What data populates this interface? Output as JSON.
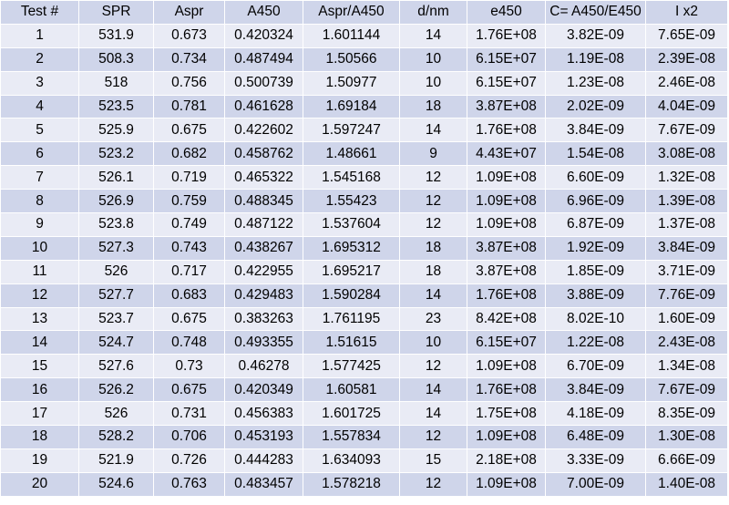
{
  "table": {
    "headers": [
      "Test #",
      "SPR",
      "Aspr",
      "A450",
      "Aspr/A450",
      "d/nm",
      "e450",
      "C= A450/E450",
      "I x2"
    ],
    "rows": [
      [
        "1",
        "531.9",
        "0.673",
        "0.420324",
        "1.601144",
        "14",
        "1.76E+08",
        "3.82E-09",
        "7.65E-09"
      ],
      [
        "2",
        "508.3",
        "0.734",
        "0.487494",
        "1.50566",
        "10",
        "6.15E+07",
        "1.19E-08",
        "2.39E-08"
      ],
      [
        "3",
        "518",
        "0.756",
        "0.500739",
        "1.50977",
        "10",
        "6.15E+07",
        "1.23E-08",
        "2.46E-08"
      ],
      [
        "4",
        "523.5",
        "0.781",
        "0.461628",
        "1.69184",
        "18",
        "3.87E+08",
        "2.02E-09",
        "4.04E-09"
      ],
      [
        "5",
        "525.9",
        "0.675",
        "0.422602",
        "1.597247",
        "14",
        "1.76E+08",
        "3.84E-09",
        "7.67E-09"
      ],
      [
        "6",
        "523.2",
        "0.682",
        "0.458762",
        "1.48661",
        "9",
        "4.43E+07",
        "1.54E-08",
        "3.08E-08"
      ],
      [
        "7",
        "526.1",
        "0.719",
        "0.465322",
        "1.545168",
        "12",
        "1.09E+08",
        "6.60E-09",
        "1.32E-08"
      ],
      [
        "8",
        "526.9",
        "0.759",
        "0.488345",
        "1.55423",
        "12",
        "1.09E+08",
        "6.96E-09",
        "1.39E-08"
      ],
      [
        "9",
        "523.8",
        "0.749",
        "0.487122",
        "1.537604",
        "12",
        "1.09E+08",
        "6.87E-09",
        "1.37E-08"
      ],
      [
        "10",
        "527.3",
        "0.743",
        "0.438267",
        "1.695312",
        "18",
        "3.87E+08",
        "1.92E-09",
        "3.84E-09"
      ],
      [
        "11",
        "526",
        "0.717",
        "0.422955",
        "1.695217",
        "18",
        "3.87E+08",
        "1.85E-09",
        "3.71E-09"
      ],
      [
        "12",
        "527.7",
        "0.683",
        "0.429483",
        "1.590284",
        "14",
        "1.76E+08",
        "3.88E-09",
        "7.76E-09"
      ],
      [
        "13",
        "523.7",
        "0.675",
        "0.383263",
        "1.761195",
        "23",
        "8.42E+08",
        "8.02E-10",
        "1.60E-09"
      ],
      [
        "14",
        "524.7",
        "0.748",
        "0.493355",
        "1.51615",
        "10",
        "6.15E+07",
        "1.22E-08",
        "2.43E-08"
      ],
      [
        "15",
        "527.6",
        "0.73",
        "0.46278",
        "1.577425",
        "12",
        "1.09E+08",
        "6.70E-09",
        "1.34E-08"
      ],
      [
        "16",
        "526.2",
        "0.675",
        "0.420349",
        "1.60581",
        "14",
        "1.76E+08",
        "3.84E-09",
        "7.67E-09"
      ],
      [
        "17",
        "526",
        "0.731",
        "0.456383",
        "1.601725",
        "14",
        "1.75E+08",
        "4.18E-09",
        "8.35E-09"
      ],
      [
        "18",
        "528.2",
        "0.706",
        "0.453193",
        "1.557834",
        "12",
        "1.09E+08",
        "6.48E-09",
        "1.30E-08"
      ],
      [
        "19",
        "521.9",
        "0.726",
        "0.444283",
        "1.634093",
        "15",
        "2.18E+08",
        "3.33E-09",
        "6.66E-09"
      ],
      [
        "20",
        "524.6",
        "0.763",
        "0.483457",
        "1.578218",
        "12",
        "1.09E+08",
        "7.00E-09",
        "1.40E-08"
      ]
    ]
  },
  "colors": {
    "header_fill": "#cfd5ea",
    "row_light": "#e9ebf5",
    "row_dark": "#cfd5ea",
    "grid_line": "#ffffff",
    "text": "#000000"
  }
}
